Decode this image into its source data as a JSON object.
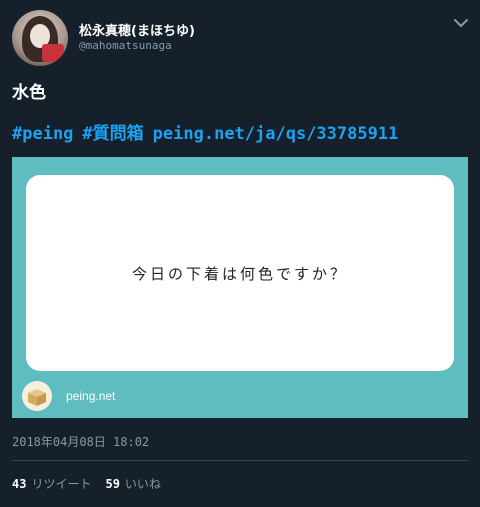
{
  "user": {
    "display_name": "松永真穂(まほちゆ)",
    "handle": "@mahomatsunaga"
  },
  "tweet": {
    "text": "水色",
    "hashtag_1": "#peing",
    "hashtag_2": "#質問箱",
    "link": "peing.net/ja/qs/33785911",
    "timestamp": "2018年04月08日 18:02"
  },
  "card": {
    "question": "今日の下着は何色ですか？",
    "domain": "peing.net",
    "background_color": "#5fbdbf"
  },
  "stats": {
    "retweets_count": "43",
    "retweets_label": "リツイート",
    "likes_count": "59",
    "likes_label": "いいね"
  },
  "icons": {
    "menu": "chevron-down-icon",
    "card_logo": "peing-box-icon"
  },
  "colors": {
    "background": "#15202b",
    "link": "#1da1f2",
    "muted": "#8899a6"
  }
}
